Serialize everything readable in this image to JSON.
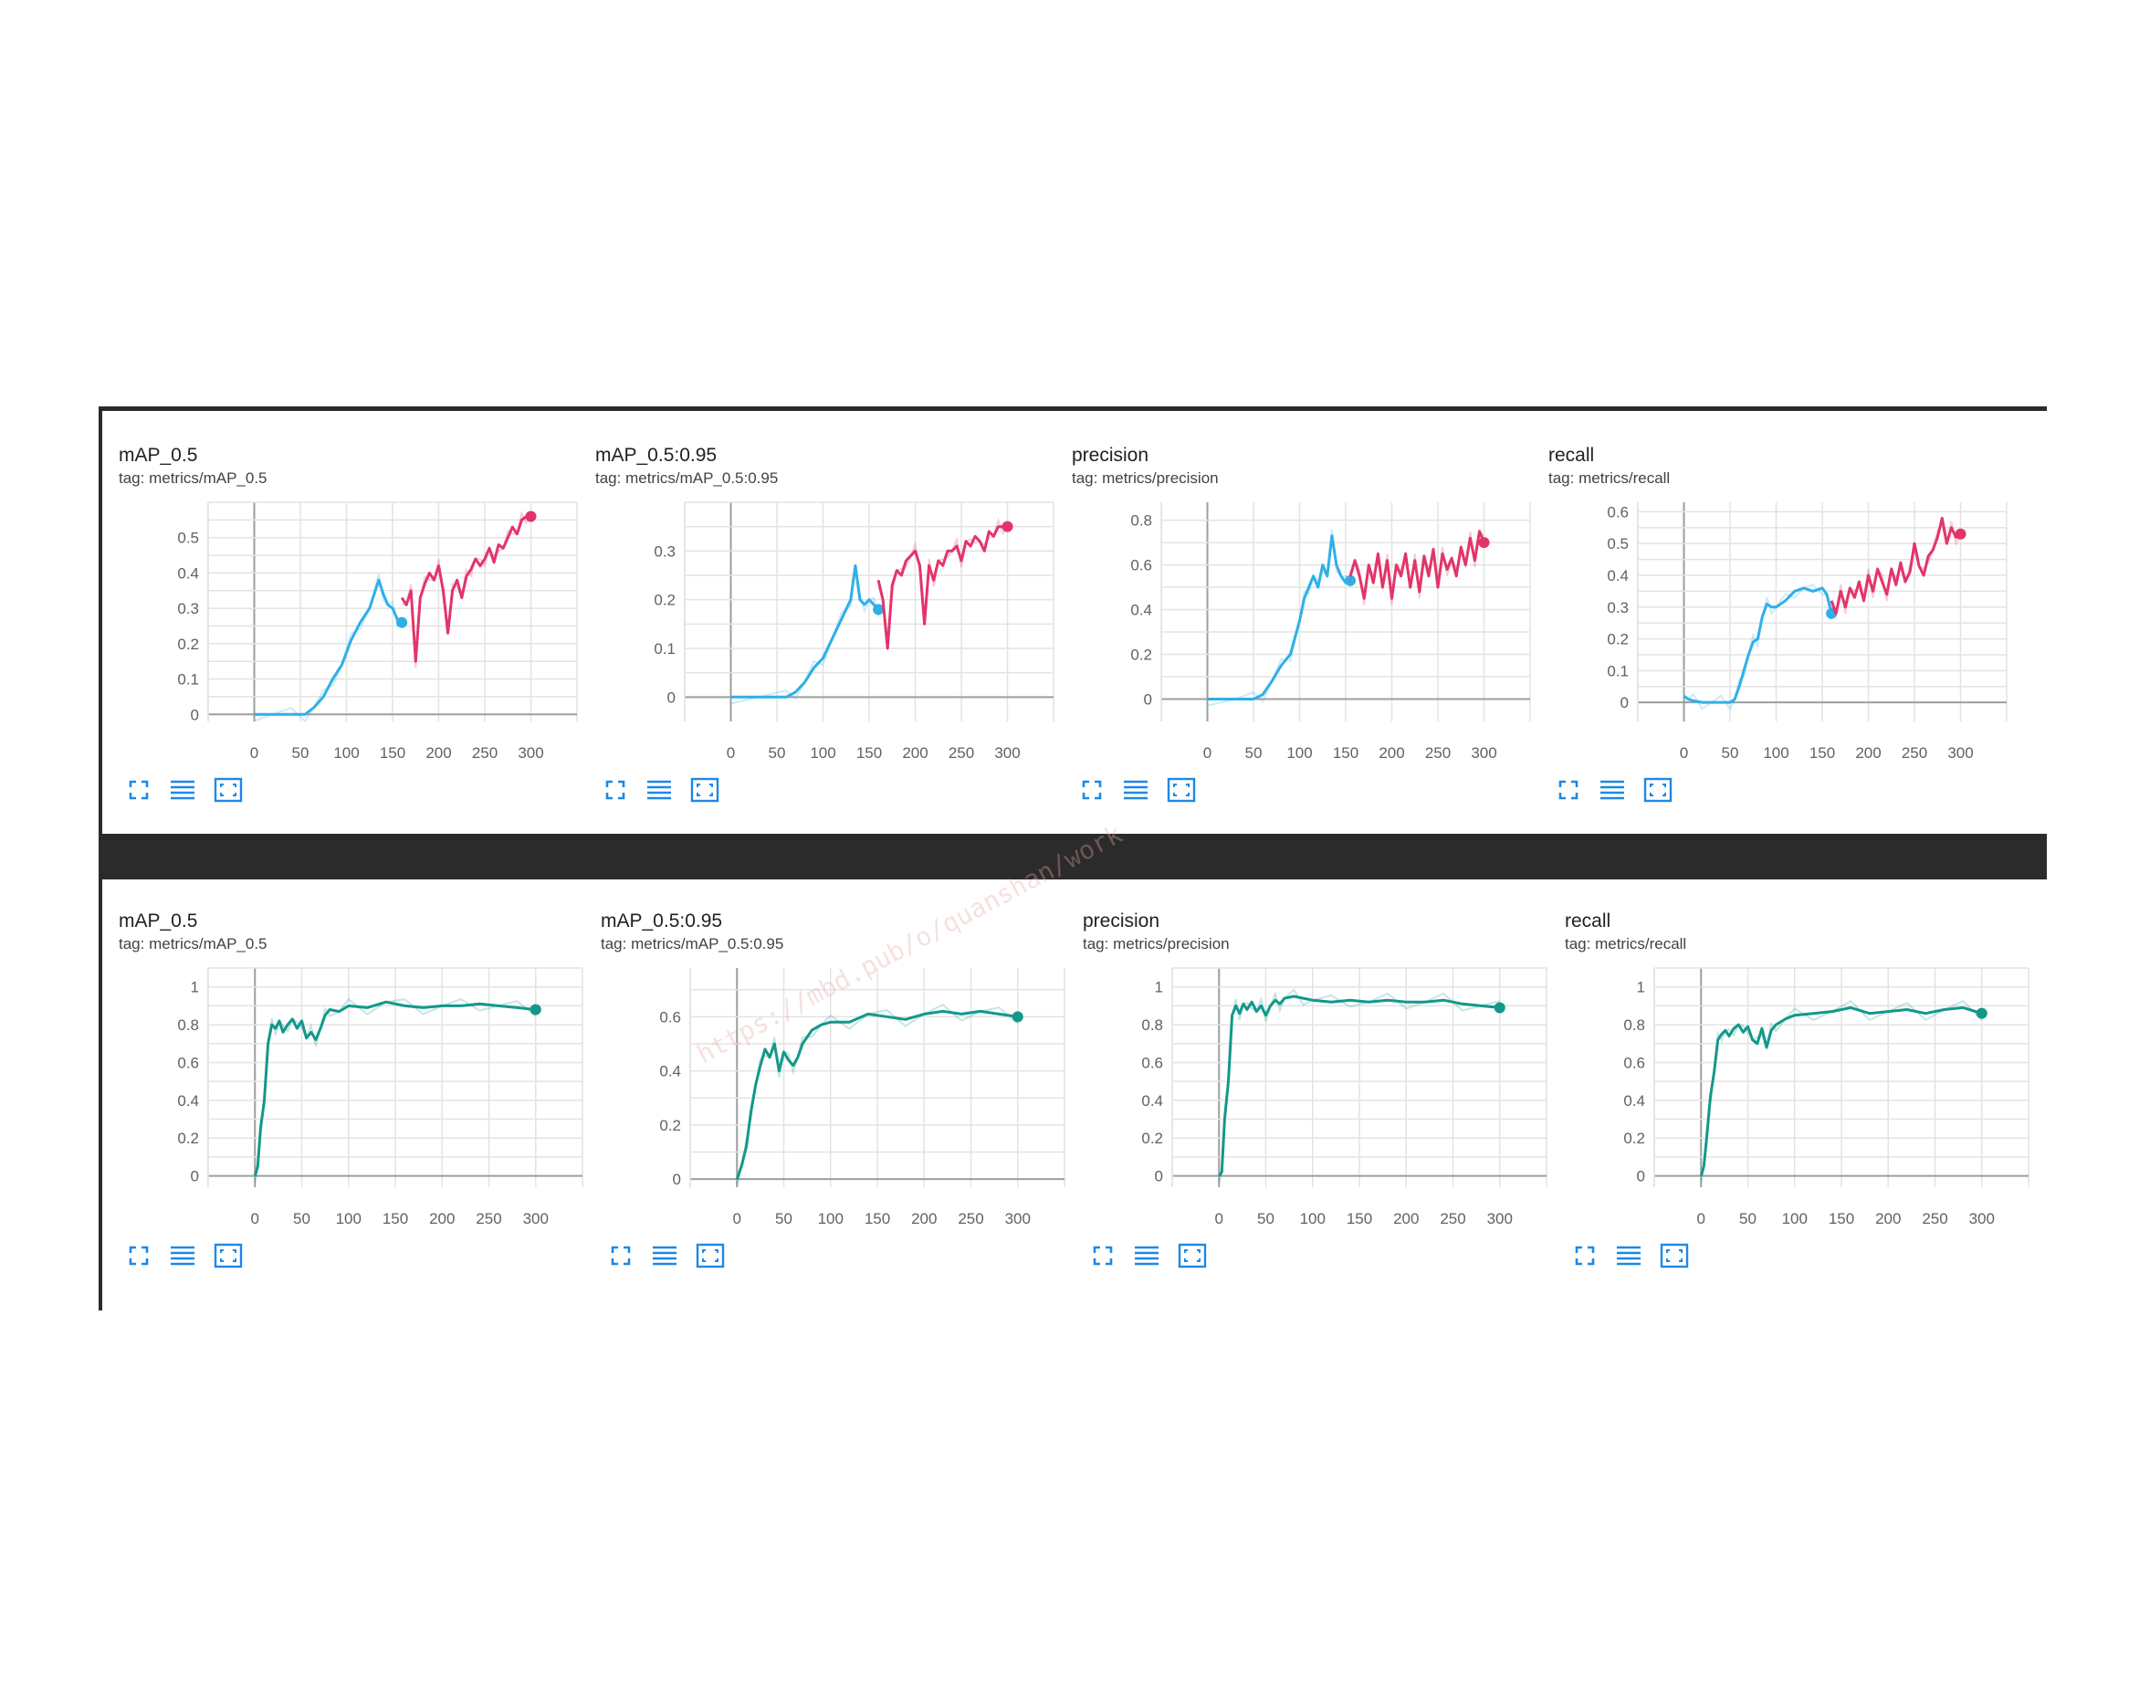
{
  "watermark": "https://mbd.pub/o/quanshan/work",
  "colors": {
    "baseline_color": "#2eb0e6",
    "finetune_color": "#e3346a",
    "final_color": "#12988a",
    "panel_bg": "#ffffff",
    "divider": "#2b2b2b"
  },
  "controls": [
    "fit-screen-icon",
    "toggle-y-axis-icon",
    "fit-domain-icon"
  ],
  "chart_data": [
    {
      "type": "line",
      "row": 1,
      "title": "mAP_0.5",
      "tag": "tag: metrics/mAP_0.5",
      "xlim": [
        -50,
        350
      ],
      "ylim": [
        -0.02,
        0.6
      ],
      "xticks": [
        0,
        50,
        100,
        150,
        200,
        250,
        300
      ],
      "yticks": [
        0,
        0.1,
        0.2,
        0.3,
        0.4,
        0.5
      ],
      "yticklabels": [
        "0",
        "0.1",
        "0.2",
        "0.3",
        "0.4",
        "0.5"
      ],
      "series": [
        {
          "color": "#2eb0e6",
          "x": [
            0,
            20,
            40,
            55,
            65,
            75,
            85,
            95,
            105,
            115,
            125,
            135,
            140,
            145,
            150,
            155,
            160
          ],
          "y": [
            0,
            0,
            0,
            0,
            0.02,
            0.05,
            0.1,
            0.14,
            0.21,
            0.26,
            0.3,
            0.38,
            0.34,
            0.31,
            0.3,
            0.27,
            0.26
          ]
        },
        {
          "color": "#e3346a",
          "x": [
            160,
            165,
            170,
            175,
            180,
            185,
            190,
            195,
            200,
            205,
            210,
            215,
            220,
            225,
            230,
            235,
            240,
            245,
            250,
            255,
            260,
            265,
            270,
            275,
            280,
            285,
            290,
            295,
            300
          ],
          "y": [
            0.33,
            0.31,
            0.35,
            0.15,
            0.33,
            0.37,
            0.4,
            0.38,
            0.42,
            0.35,
            0.23,
            0.35,
            0.38,
            0.33,
            0.39,
            0.41,
            0.44,
            0.42,
            0.44,
            0.47,
            0.43,
            0.48,
            0.47,
            0.5,
            0.53,
            0.51,
            0.55,
            0.56,
            0.56
          ]
        }
      ]
    },
    {
      "type": "line",
      "row": 1,
      "title": "mAP_0.5:0.95",
      "tag": "tag: metrics/mAP_0.5:0.95",
      "xlim": [
        -50,
        350
      ],
      "ylim": [
        -0.05,
        0.4
      ],
      "xticks": [
        0,
        50,
        100,
        150,
        200,
        250,
        300
      ],
      "yticks": [
        0,
        0.1,
        0.2,
        0.3
      ],
      "yticklabels": [
        "0",
        "0.1",
        "0.2",
        "0.3"
      ],
      "series": [
        {
          "color": "#2eb0e6",
          "x": [
            0,
            30,
            60,
            70,
            80,
            90,
            100,
            110,
            120,
            130,
            135,
            140,
            145,
            150,
            155,
            160
          ],
          "y": [
            0,
            0,
            0,
            0.01,
            0.03,
            0.06,
            0.08,
            0.12,
            0.16,
            0.2,
            0.27,
            0.2,
            0.19,
            0.2,
            0.19,
            0.18
          ]
        },
        {
          "color": "#e3346a",
          "x": [
            160,
            165,
            170,
            175,
            180,
            185,
            190,
            195,
            200,
            205,
            210,
            215,
            220,
            225,
            230,
            235,
            240,
            245,
            250,
            255,
            260,
            265,
            270,
            275,
            280,
            285,
            290,
            295,
            300
          ],
          "y": [
            0.24,
            0.2,
            0.1,
            0.23,
            0.26,
            0.25,
            0.28,
            0.29,
            0.3,
            0.27,
            0.15,
            0.27,
            0.24,
            0.28,
            0.27,
            0.3,
            0.3,
            0.31,
            0.28,
            0.32,
            0.31,
            0.33,
            0.32,
            0.3,
            0.34,
            0.33,
            0.35,
            0.35,
            0.35
          ]
        }
      ]
    },
    {
      "type": "line",
      "row": 1,
      "title": "precision",
      "tag": "tag: metrics/precision",
      "xlim": [
        -50,
        350
      ],
      "ylim": [
        -0.1,
        0.88
      ],
      "xticks": [
        0,
        50,
        100,
        150,
        200,
        250,
        300
      ],
      "yticks": [
        0,
        0.2,
        0.4,
        0.6,
        0.8
      ],
      "yticklabels": [
        "0",
        "0.2",
        "0.4",
        "0.6",
        "0.8"
      ],
      "series": [
        {
          "color": "#2eb0e6",
          "x": [
            0,
            30,
            50,
            60,
            70,
            80,
            90,
            100,
            105,
            110,
            115,
            120,
            125,
            130,
            135,
            140,
            145,
            150,
            155
          ],
          "y": [
            0,
            0,
            0,
            0.02,
            0.08,
            0.15,
            0.2,
            0.35,
            0.45,
            0.5,
            0.55,
            0.5,
            0.6,
            0.55,
            0.73,
            0.6,
            0.55,
            0.52,
            0.53
          ]
        },
        {
          "color": "#e3346a",
          "x": [
            155,
            160,
            165,
            170,
            175,
            180,
            185,
            190,
            195,
            200,
            205,
            210,
            215,
            220,
            225,
            230,
            235,
            240,
            245,
            250,
            255,
            260,
            265,
            270,
            275,
            280,
            285,
            290,
            295,
            300
          ],
          "y": [
            0.55,
            0.62,
            0.55,
            0.45,
            0.6,
            0.52,
            0.65,
            0.5,
            0.62,
            0.45,
            0.6,
            0.55,
            0.65,
            0.5,
            0.62,
            0.48,
            0.64,
            0.55,
            0.67,
            0.5,
            0.65,
            0.58,
            0.63,
            0.55,
            0.68,
            0.6,
            0.72,
            0.62,
            0.75,
            0.7
          ]
        }
      ]
    },
    {
      "type": "line",
      "row": 1,
      "title": "recall",
      "tag": "tag: metrics/recall",
      "xlim": [
        -50,
        350
      ],
      "ylim": [
        -0.06,
        0.63
      ],
      "xticks": [
        0,
        50,
        100,
        150,
        200,
        250,
        300
      ],
      "yticks": [
        0,
        0.1,
        0.2,
        0.3,
        0.4,
        0.5,
        0.6
      ],
      "yticklabels": [
        "0",
        "0.1",
        "0.2",
        "0.3",
        "0.4",
        "0.5",
        "0.6"
      ],
      "series": [
        {
          "color": "#2eb0e6",
          "x": [
            0,
            5,
            10,
            20,
            30,
            40,
            50,
            55,
            60,
            65,
            70,
            75,
            80,
            85,
            90,
            95,
            100,
            110,
            120,
            130,
            140,
            150,
            155,
            160
          ],
          "y": [
            0.02,
            0.01,
            0.005,
            0,
            0,
            0,
            0,
            0.01,
            0.05,
            0.1,
            0.15,
            0.19,
            0.2,
            0.27,
            0.31,
            0.3,
            0.3,
            0.32,
            0.35,
            0.36,
            0.35,
            0.36,
            0.34,
            0.28
          ]
        },
        {
          "color": "#e3346a",
          "x": [
            160,
            165,
            170,
            175,
            180,
            185,
            190,
            195,
            200,
            205,
            210,
            215,
            220,
            225,
            230,
            235,
            240,
            245,
            250,
            255,
            260,
            265,
            270,
            275,
            280,
            285,
            290,
            295,
            300
          ],
          "y": [
            0.32,
            0.28,
            0.35,
            0.3,
            0.36,
            0.33,
            0.38,
            0.32,
            0.4,
            0.35,
            0.42,
            0.38,
            0.34,
            0.42,
            0.37,
            0.44,
            0.38,
            0.41,
            0.5,
            0.43,
            0.4,
            0.46,
            0.48,
            0.52,
            0.58,
            0.5,
            0.55,
            0.52,
            0.53
          ]
        }
      ]
    },
    {
      "type": "line",
      "row": 2,
      "title": "mAP_0.5",
      "tag": "tag: metrics/mAP_0.5",
      "xlim": [
        -50,
        350
      ],
      "ylim": [
        -0.06,
        1.1
      ],
      "xticks": [
        0,
        50,
        100,
        150,
        200,
        250,
        300
      ],
      "yticks": [
        0,
        0.2,
        0.4,
        0.6,
        0.8,
        1
      ],
      "yticklabels": [
        "0",
        "0.2",
        "0.4",
        "0.6",
        "0.8",
        "1"
      ],
      "series": [
        {
          "color": "#12988a",
          "x": [
            0,
            3,
            6,
            10,
            14,
            18,
            22,
            26,
            30,
            35,
            40,
            45,
            50,
            55,
            60,
            65,
            70,
            75,
            80,
            90,
            100,
            120,
            140,
            160,
            180,
            200,
            220,
            240,
            260,
            280,
            300
          ],
          "y": [
            0,
            0.05,
            0.25,
            0.4,
            0.7,
            0.8,
            0.78,
            0.82,
            0.76,
            0.8,
            0.83,
            0.78,
            0.82,
            0.73,
            0.76,
            0.72,
            0.78,
            0.85,
            0.88,
            0.87,
            0.9,
            0.89,
            0.92,
            0.9,
            0.89,
            0.9,
            0.9,
            0.91,
            0.9,
            0.89,
            0.88
          ]
        }
      ]
    },
    {
      "type": "line",
      "row": 2,
      "title": "mAP_0.5:0.95",
      "tag": "tag: metrics/mAP_0.5:0.95",
      "xlim": [
        -50,
        350
      ],
      "ylim": [
        -0.03,
        0.78
      ],
      "xticks": [
        0,
        50,
        100,
        150,
        200,
        250,
        300
      ],
      "yticks": [
        0,
        0.2,
        0.4,
        0.6
      ],
      "yticklabels": [
        "0",
        "0.2",
        "0.4",
        "0.6"
      ],
      "series": [
        {
          "color": "#12988a",
          "x": [
            0,
            5,
            10,
            15,
            20,
            25,
            30,
            35,
            40,
            45,
            50,
            55,
            60,
            65,
            70,
            80,
            90,
            100,
            120,
            140,
            160,
            180,
            200,
            220,
            240,
            260,
            280,
            300
          ],
          "y": [
            0,
            0.05,
            0.12,
            0.25,
            0.35,
            0.42,
            0.48,
            0.45,
            0.5,
            0.4,
            0.47,
            0.44,
            0.42,
            0.45,
            0.5,
            0.55,
            0.57,
            0.58,
            0.58,
            0.61,
            0.6,
            0.59,
            0.61,
            0.62,
            0.61,
            0.62,
            0.61,
            0.6
          ]
        }
      ]
    },
    {
      "type": "line",
      "row": 2,
      "title": "precision",
      "tag": "tag: metrics/precision",
      "xlim": [
        -50,
        350
      ],
      "ylim": [
        -0.06,
        1.1
      ],
      "xticks": [
        0,
        50,
        100,
        150,
        200,
        250,
        300
      ],
      "yticks": [
        0,
        0.2,
        0.4,
        0.6,
        0.8,
        1
      ],
      "yticklabels": [
        "0",
        "0.2",
        "0.4",
        "0.6",
        "0.8",
        "1"
      ],
      "series": [
        {
          "color": "#12988a",
          "x": [
            0,
            3,
            6,
            10,
            14,
            18,
            22,
            26,
            30,
            35,
            40,
            45,
            50,
            55,
            60,
            65,
            70,
            80,
            90,
            100,
            120,
            140,
            160,
            180,
            200,
            220,
            240,
            260,
            280,
            300
          ],
          "y": [
            0,
            0.02,
            0.3,
            0.5,
            0.85,
            0.9,
            0.86,
            0.91,
            0.88,
            0.92,
            0.87,
            0.9,
            0.85,
            0.9,
            0.93,
            0.91,
            0.94,
            0.95,
            0.94,
            0.93,
            0.92,
            0.93,
            0.92,
            0.93,
            0.92,
            0.92,
            0.93,
            0.91,
            0.9,
            0.89
          ]
        }
      ]
    },
    {
      "type": "line",
      "row": 2,
      "title": "recall",
      "tag": "tag: metrics/recall",
      "xlim": [
        -50,
        350
      ],
      "ylim": [
        -0.06,
        1.1
      ],
      "xticks": [
        0,
        50,
        100,
        150,
        200,
        250,
        300
      ],
      "yticks": [
        0,
        0.2,
        0.4,
        0.6,
        0.8,
        1
      ],
      "yticklabels": [
        "0",
        "0.2",
        "0.4",
        "0.6",
        "0.8",
        "1"
      ],
      "series": [
        {
          "color": "#12988a",
          "x": [
            0,
            3,
            6,
            10,
            14,
            18,
            22,
            26,
            30,
            35,
            40,
            45,
            50,
            55,
            60,
            65,
            70,
            75,
            80,
            90,
            100,
            120,
            140,
            160,
            180,
            200,
            220,
            240,
            260,
            280,
            300
          ],
          "y": [
            0,
            0.05,
            0.2,
            0.42,
            0.55,
            0.72,
            0.75,
            0.77,
            0.74,
            0.78,
            0.8,
            0.76,
            0.79,
            0.72,
            0.7,
            0.78,
            0.68,
            0.77,
            0.8,
            0.83,
            0.85,
            0.86,
            0.87,
            0.89,
            0.86,
            0.87,
            0.88,
            0.86,
            0.88,
            0.89,
            0.86
          ]
        }
      ]
    }
  ]
}
